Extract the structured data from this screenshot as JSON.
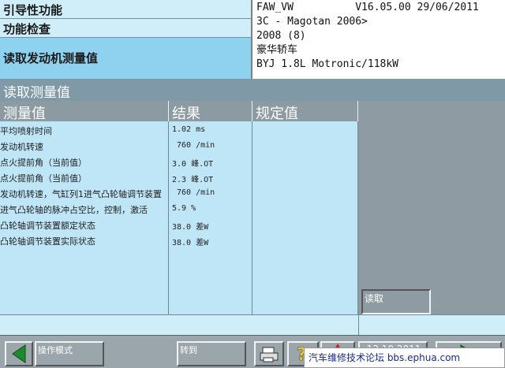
{
  "header": {
    "left_line1": "引导性功能",
    "left_line2": "功能检查",
    "left_line3": "读取发动机测量值",
    "vehicle_info": [
      "FAW_VW          V16.05.00 29/06/2011",
      "3C - Magotan 2006>",
      "2008 (8)",
      "豪华轿车",
      "BYJ 1.8L Motronic/118kW"
    ]
  },
  "title": "读取测量值",
  "table": {
    "columns": [
      "测量值",
      "结果",
      "规定值"
    ],
    "rows": [
      {
        "name": "平均喷射时间",
        "result": "1.02 ms"
      },
      {
        "name": "发动机转速",
        "result": " 760 /min"
      },
      {
        "name": "点火提前角（当前值）",
        "result": "3.0 峰.OT"
      },
      {
        "name": "点火提前角（当前值）",
        "result": "2.3 峰.OT"
      },
      {
        "name": "发动机转速，气缸列1进气凸轮轴调节装置",
        "result": " 760 /min"
      },
      {
        "name": "进气凸轮轴的脉冲占空比，控制，激活",
        "result": "5.9 %"
      },
      {
        "name": "凸轮轴调节装置额定状态",
        "result": "38.0 差W"
      },
      {
        "name": "凸轮轴调节装置实际状态",
        "result": "38.0 差W"
      }
    ]
  },
  "read_button": "读取",
  "toolbar": {
    "mode_label": "操作模式",
    "goto_label": "转到",
    "date": "13.10.2011",
    "watermark": "汽车维修技术论坛 bbs.ephua.com"
  }
}
